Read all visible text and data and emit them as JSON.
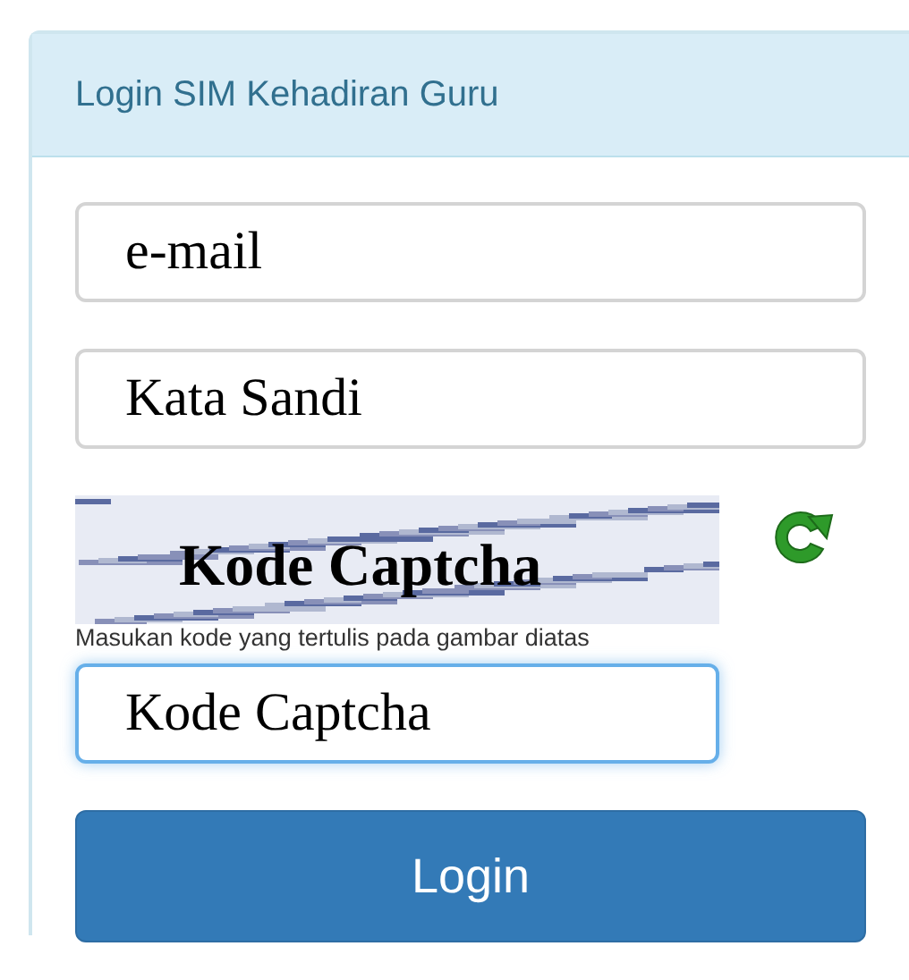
{
  "panel": {
    "title": "Login SIM Kehadiran Guru"
  },
  "fields": [
    {
      "placeholder": "e-mail",
      "focused": false
    },
    {
      "placeholder": "Kata Sandi",
      "focused": false
    }
  ],
  "captcha": {
    "label": "Kode Captcha",
    "hint": "Masukan kode yang tertulis pada gambar diatas",
    "field": {
      "placeholder": "Kode Captcha",
      "focused": true
    }
  },
  "button": "Login"
}
